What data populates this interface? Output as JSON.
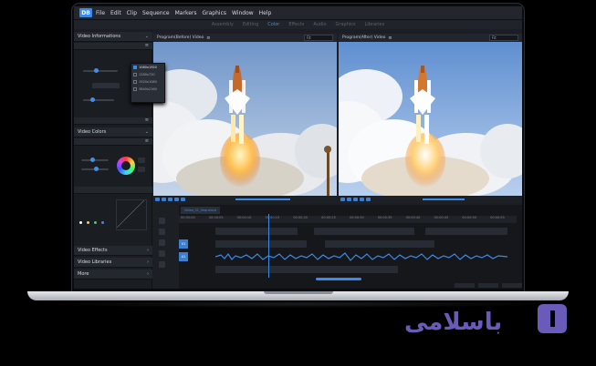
{
  "app": {
    "logo": "DB"
  },
  "menu": [
    "File",
    "Edit",
    "Clip",
    "Sequence",
    "Markers",
    "Graphics",
    "Window",
    "Help"
  ],
  "workspaces": {
    "items": [
      "Assembly",
      "Editing",
      "Color",
      "Effects",
      "Audio",
      "Graphics",
      "Libraries"
    ],
    "active": "Color"
  },
  "left_panel": {
    "video_info": {
      "title": "Video Informations"
    },
    "popup_options": [
      "1080x1920",
      "1280x720",
      "1920x1080",
      "3840x2160"
    ],
    "video_colors": {
      "title": "Video Colors"
    },
    "sections": [
      "Video Effects",
      "Video Libraries",
      "More"
    ]
  },
  "monitors": {
    "before": {
      "label": "Program(Before) Video",
      "select": "Fit"
    },
    "after": {
      "label": "Program(After) Video",
      "select": "Fit"
    }
  },
  "timeline": {
    "sequence_tab": "Video_01_Sequence",
    "ruler": [
      "00:00:00",
      "00:00:05",
      "00:00:10",
      "00:00:15",
      "00:00:20",
      "00:00:25",
      "00:00:30",
      "00:00:35",
      "00:00:40",
      "00:00:45",
      "00:00:50",
      "00:00:55"
    ],
    "tracks": {
      "v1": "V1",
      "a1": "A1"
    }
  },
  "watermark": {
    "text": "باسلامی"
  },
  "colors": {
    "accent": "#3c8ae8",
    "panel": "#1a1d22",
    "sky": "#a8c0e0"
  }
}
